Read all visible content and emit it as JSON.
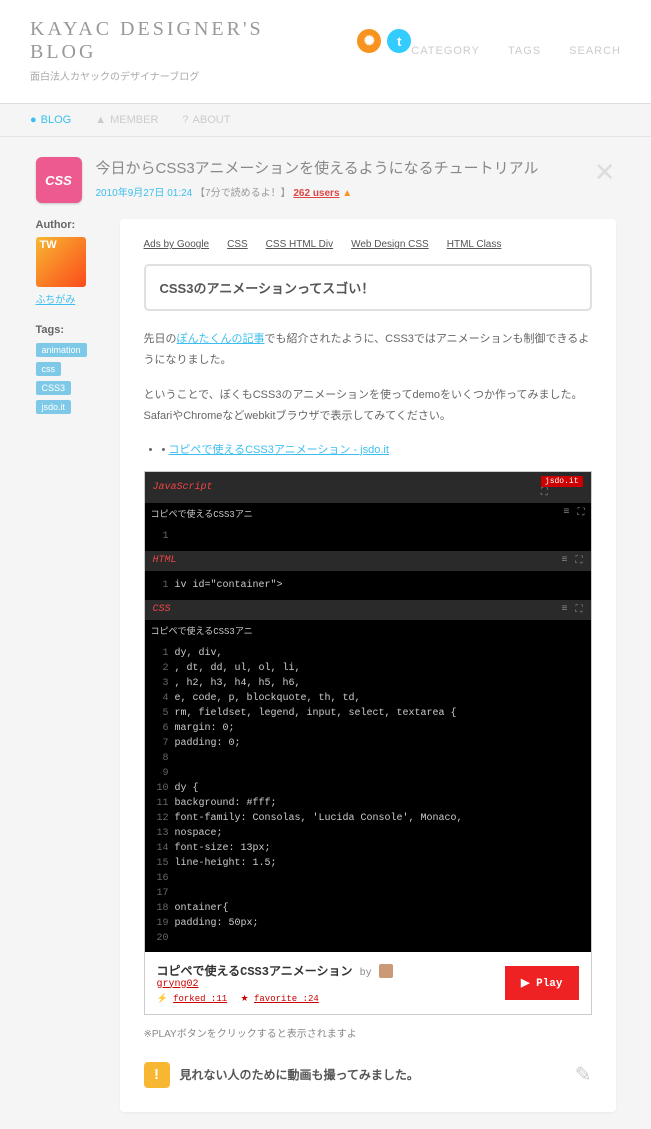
{
  "header": {
    "title": "KAYAC DESIGNER'S BLOG",
    "subtitle": "面白法人カヤックのデザイナーブログ",
    "nav": {
      "category": "CATEGORY",
      "tags": "TAGS",
      "search": "SEARCH"
    }
  },
  "subnav": {
    "blog": "BLOG",
    "member": "MEMBER",
    "about": "ABOUT"
  },
  "article": {
    "badge": "CSS",
    "title": "今日からCSS3アニメーションを使えるようになるチュートリアル",
    "date": "2010年9月27日 01:24",
    "readtime": "【7分で読めるよ！】",
    "users": "262 users"
  },
  "sidebar": {
    "author_h": "Author:",
    "author": "ふちがみ",
    "tags_h": "Tags:",
    "tags": [
      "animation",
      "css",
      "CSS3",
      "jsdo.it"
    ]
  },
  "ads": {
    "by": "Ads by Google",
    "l1": "CSS",
    "l2": "CSS HTML Div",
    "l3": "Web Design CSS",
    "l4": "HTML Class"
  },
  "content": {
    "callout": "CSS3のアニメーションってスゴい！",
    "p1a": "先日の",
    "p1link": "ぽんたくんの記事",
    "p1b": "でも紹介されたように、CSS3ではアニメーションも制御できるようになりました。",
    "p2": "ということで、ぼくもCSS3のアニメーションを使ってdemoをいくつか作ってみました。\nSafariやChromeなどwebkitブラウザで表示してみてください。",
    "bullet": "コピペで使えるCSS3アニメーション - jsdo.it",
    "note": "※PLAYボタンをクリックすると表示されますよ",
    "vid": "見れない人のために動画も撮ってみました。"
  },
  "embed": {
    "js_label": "JavaScript",
    "js_sub": "コピペで使えるCSS3アニ",
    "html_label": "HTML",
    "html_code": "iv id=\"container\">",
    "css_label": "CSS",
    "css_sub": "コピペで使えるCSS3アニ",
    "jsdo": "jsdo.it",
    "css_lines": [
      "dy, div,",
      ", dt, dd, ul, ol, li,",
      ", h2, h3, h4, h5, h6,",
      "e, code, p, blockquote, th, td,",
      "rm, fieldset, legend, input, select, textarea {",
      "margin: 0;",
      "padding: 0;",
      "",
      "",
      "dy {",
      "background: #fff;",
      "font-family: Consolas, 'Lucida Console', Monaco,",
      "nospace;",
      "font-size: 13px;",
      "line-height: 1.5;",
      "",
      "",
      "ontainer{",
      "padding: 50px;",
      ""
    ],
    "footer_title": "コピペで使えるCSS3アニメーション",
    "footer_by": "by",
    "footer_author": "gryng02",
    "forked": "forked :11",
    "favorite": "favorite :24",
    "play": "▶ Play"
  }
}
